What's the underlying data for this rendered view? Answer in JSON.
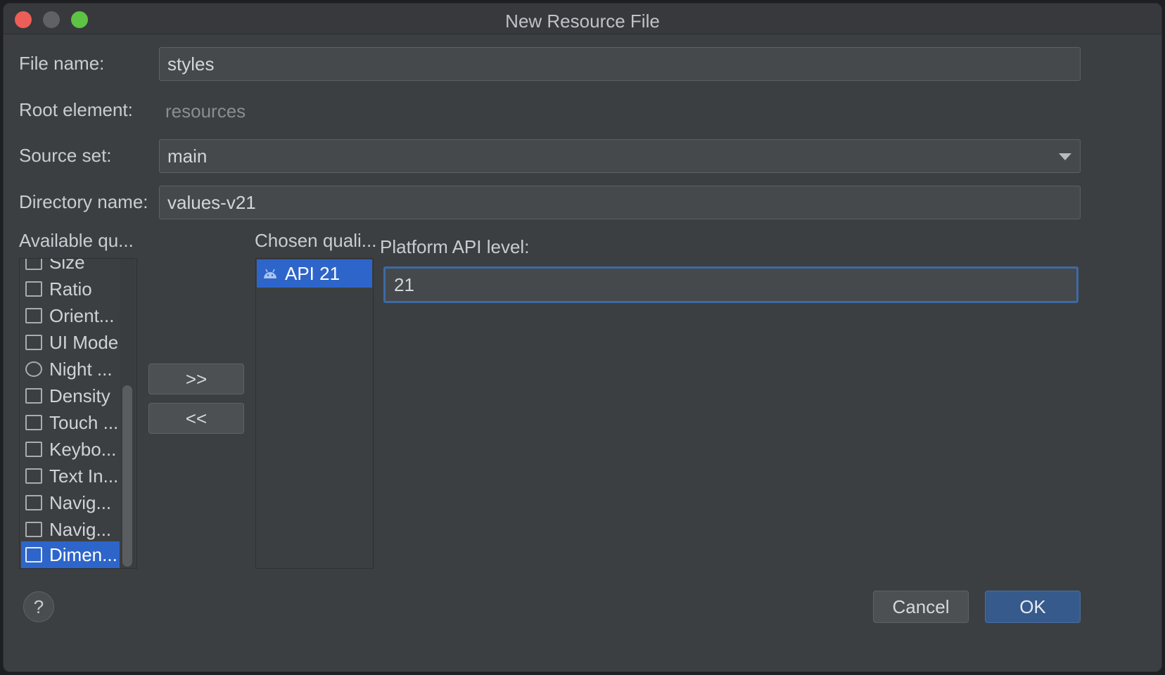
{
  "window": {
    "title": "New Resource File"
  },
  "form": {
    "file_name_label": "File name:",
    "file_name_value": "styles",
    "root_element_label": "Root element:",
    "root_element_value": "resources",
    "source_set_label": "Source set:",
    "source_set_value": "main",
    "directory_name_label": "Directory name:",
    "directory_name_value": "values-v21"
  },
  "available": {
    "header": "Available qu...",
    "items": [
      {
        "label": "Size",
        "icon": "size-icon"
      },
      {
        "label": "Ratio",
        "icon": "ratio-icon"
      },
      {
        "label": "Orient...",
        "icon": "orientation-icon"
      },
      {
        "label": "UI Mode",
        "icon": "ui-mode-icon"
      },
      {
        "label": "Night ...",
        "icon": "night-mode-icon"
      },
      {
        "label": "Density",
        "icon": "density-icon"
      },
      {
        "label": "Touch ...",
        "icon": "touch-icon"
      },
      {
        "label": "Keybo...",
        "icon": "keyboard-icon"
      },
      {
        "label": "Text In...",
        "icon": "text-input-icon"
      },
      {
        "label": "Navig...",
        "icon": "navigation-state-icon"
      },
      {
        "label": "Navig...",
        "icon": "navigation-method-icon"
      },
      {
        "label": "Dimen...",
        "icon": "dimension-icon",
        "selected": true
      }
    ]
  },
  "transfer": {
    "add_label": ">>",
    "remove_label": "<<"
  },
  "chosen": {
    "header": "Chosen quali...",
    "items": [
      {
        "label": "API 21",
        "icon": "android-icon"
      }
    ]
  },
  "detail": {
    "label": "Platform API level:",
    "value": "21"
  },
  "footer": {
    "help_label": "?",
    "cancel_label": "Cancel",
    "ok_label": "OK"
  },
  "colors": {
    "accent": "#2e65ca",
    "focus_border": "#3d6aa5",
    "background": "#3c3f41"
  }
}
